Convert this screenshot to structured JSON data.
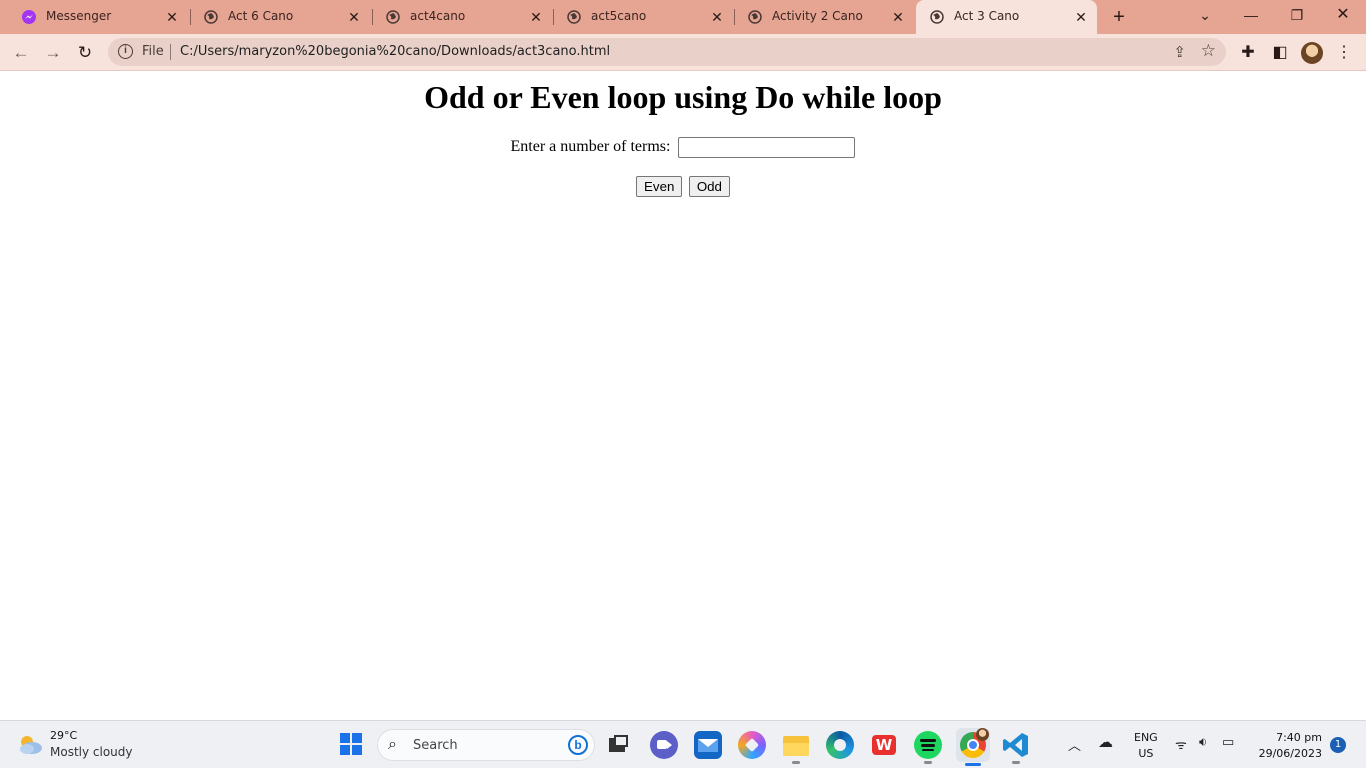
{
  "browser": {
    "tabs": [
      {
        "title": "Messenger",
        "icon": "messenger-icon"
      },
      {
        "title": "Act 6 Cano",
        "icon": "globe-icon"
      },
      {
        "title": "act4cano",
        "icon": "globe-icon"
      },
      {
        "title": "act5cano",
        "icon": "globe-icon"
      },
      {
        "title": "Activity 2 Cano",
        "icon": "globe-icon"
      },
      {
        "title": "Act 3 Cano",
        "icon": "globe-icon",
        "active": true
      }
    ],
    "omnibox": {
      "scheme_label": "File",
      "url": "C:/Users/maryzon%20begonia%20cano/Downloads/act3cano.html"
    },
    "colors": {
      "tabstrip": "#e6a493",
      "toolbar": "#f8e3dc"
    }
  },
  "page": {
    "heading": "Odd or Even loop using Do while loop",
    "input_label": "Enter a number of terms:",
    "input_value": "",
    "buttons": {
      "even": "Even",
      "odd": "Odd"
    }
  },
  "taskbar": {
    "weather": {
      "temp": "29°C",
      "desc": "Mostly cloudy"
    },
    "search_placeholder": "Search",
    "apps": [
      "task-view",
      "meet",
      "mail",
      "copilot",
      "file-explorer",
      "edge",
      "wps",
      "spotify",
      "chrome",
      "vscode"
    ],
    "language": {
      "line1": "ENG",
      "line2": "US"
    },
    "clock": {
      "time": "7:40 pm",
      "date": "29/06/2023"
    },
    "notification_count": "1"
  }
}
